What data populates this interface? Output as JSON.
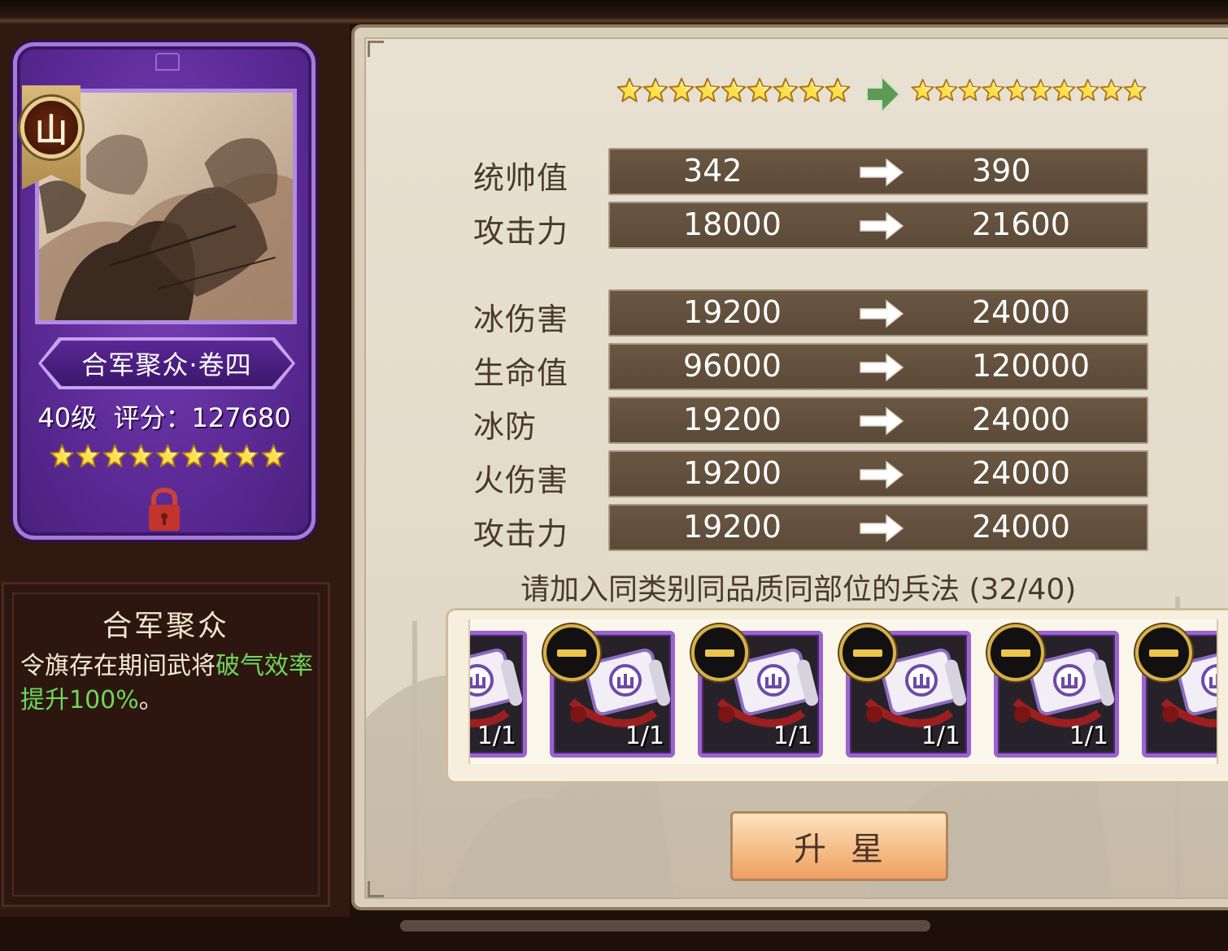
{
  "card": {
    "badge_char": "山",
    "name": "合军聚众·卷四",
    "level_score": "40级  评分：127680",
    "stars": 9,
    "lock_icon": "lock-icon"
  },
  "skill": {
    "title": "合军聚众",
    "desc_prefix": "令旗存在期间武将",
    "desc_highlight": "破气效率提升100%",
    "desc_suffix": "。",
    "highlight_color": "#6ed85a"
  },
  "star_upgrade": {
    "current_stars": 9,
    "next_stars": 10,
    "arrow_icon": "green-arrow-icon"
  },
  "stats_group1": [
    {
      "label": "统帅值",
      "from": "342",
      "to": "390"
    },
    {
      "label": "攻击力",
      "from": "18000",
      "to": "21600"
    }
  ],
  "stats_group2": [
    {
      "label": "冰伤害",
      "from": "19200",
      "to": "24000"
    },
    {
      "label": "生命值",
      "from": "96000",
      "to": "120000"
    },
    {
      "label": "冰防",
      "from": "19200",
      "to": "24000"
    },
    {
      "label": "火伤害",
      "from": "19200",
      "to": "24000"
    },
    {
      "label": "攻击力",
      "from": "19200",
      "to": "24000"
    }
  ],
  "hint": "请加入同类别同品质同部位的兵法 (32/40)",
  "materials": [
    {
      "count": "1/1",
      "selected": false
    },
    {
      "count": "1/1",
      "selected": true
    },
    {
      "count": "1/1",
      "selected": true
    },
    {
      "count": "1/1",
      "selected": true
    },
    {
      "count": "1/1",
      "selected": true
    },
    {
      "count": "",
      "selected": true
    }
  ],
  "upgrade_button": "升星"
}
